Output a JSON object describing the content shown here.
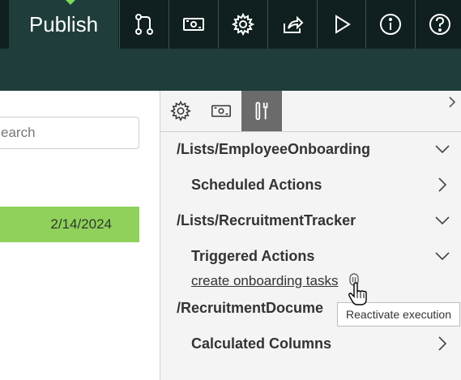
{
  "toolbar": {
    "publish_label": "Publish",
    "buttons": [
      {
        "icon": "branch-icon"
      },
      {
        "icon": "money-icon"
      },
      {
        "icon": "gear-icon"
      },
      {
        "icon": "share-icon"
      },
      {
        "icon": "play-icon"
      },
      {
        "icon": "info-icon"
      },
      {
        "icon": "help-icon"
      }
    ]
  },
  "left": {
    "search_text": "earch",
    "date": "2/14/2024"
  },
  "panel": {
    "tabs": [
      {
        "icon": "gear-icon",
        "active": false
      },
      {
        "icon": "money-icon",
        "active": false
      },
      {
        "icon": "tools-icon",
        "active": true
      }
    ],
    "items": [
      {
        "label": "/Lists/EmployeeOnboarding",
        "chevron": "down"
      },
      {
        "label": "Scheduled Actions",
        "chevron": "right"
      },
      {
        "label": "/Lists/RecruitmentTracker",
        "chevron": "down"
      },
      {
        "label": "Triggered Actions",
        "chevron": "down"
      },
      {
        "label": "/RecruitmentDocume",
        "chevron": "none"
      },
      {
        "label": "Calculated Columns",
        "chevron": "right"
      }
    ],
    "link": "create onboarding tasks",
    "tooltip": "Reactivate execution"
  },
  "colors": {
    "toolbar_bg": "#101f1f",
    "toolbar_accent": "#1f3d3a",
    "green_highlight": "#8fd15a",
    "active_tab": "#6b6b6b"
  }
}
